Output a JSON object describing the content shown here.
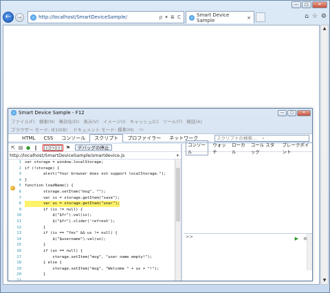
{
  "browser": {
    "url": "http://localhost/SmartDeviceSample/",
    "address_controls": "ρ ▾ ≣ C",
    "tab_title": "Smart Device Sample",
    "tab_close": "×",
    "back": "←",
    "forward": "→",
    "window_buttons": {
      "min": "—",
      "max": "□",
      "close": "✕"
    },
    "right_icons": {
      "home": "⌂",
      "favorites": "☆",
      "settings": "⚙"
    }
  },
  "devtools": {
    "title": "Smart Device Sample - F12",
    "window_buttons": {
      "min": "—",
      "max": "□",
      "close": "✕"
    },
    "menu": [
      "ファイル(F)",
      "検索(N)",
      "無効化(D)",
      "表示(V)",
      "イメージ(I)",
      "キャッシュ(C)",
      "ツール(T)",
      "検証(A)"
    ],
    "mode": {
      "browser_mode": "ブラウザー モード: IE10(B)",
      "document_mode": "ドキュメント モード: 標準(M)"
    },
    "tabs": [
      {
        "label": "HTML"
      },
      {
        "label": "CSS"
      },
      {
        "label": "コンソール"
      },
      {
        "label": "スクリプト"
      },
      {
        "label": "プロファイラー"
      },
      {
        "label": "ネットワーク"
      }
    ],
    "search_placeholder": "スクリプトの検索...",
    "stop_debug_label": "デバッグの停止",
    "file_path": "http://localhost/SmartDeviceSample/smartdevice.js",
    "right_tabs": [
      "コンソール",
      "ウォッチ",
      "ローカル",
      "コール スタック",
      "ブレークポイント"
    ],
    "console_prompt": ">>",
    "code_lines": [
      {
        "n": "1",
        "t": "var storage = window.localStorage;"
      },
      {
        "n": "2",
        "t": "if (!storage) {"
      },
      {
        "n": "3",
        "t": "        alert(\"Your browser does not support localStorage.\");"
      },
      {
        "n": "4",
        "t": "}"
      },
      {
        "n": "5",
        "t": "function loadName() {"
      },
      {
        "n": "6",
        "t": "        storage.setItem(\"msg\", \"\");"
      },
      {
        "n": "7",
        "t": "        var is = storage.getItem(\"save\");"
      },
      {
        "n": "8",
        "t": "        var us = storage.getItem(\"user\");",
        "hl": true
      },
      {
        "n": "9",
        "t": "        if (is != null) {"
      },
      {
        "n": "10",
        "t": "            $(\"$fr\").val(is);"
      },
      {
        "n": "11",
        "t": "            $(\"$fr\").slider('refresh');"
      },
      {
        "n": "12",
        "t": "        }"
      },
      {
        "n": "13",
        "t": "        if (is == \"Yes\" && us != null) {"
      },
      {
        "n": "14",
        "t": "            $(\"$username\").val(us);"
      },
      {
        "n": "15",
        "t": "        }"
      },
      {
        "n": "16",
        "t": "        if (us == null) {"
      },
      {
        "n": "17",
        "t": "            storage.setItem(\"msg\", \"user name empty!\");"
      },
      {
        "n": "18",
        "t": "        } else {"
      },
      {
        "n": "19",
        "t": "            storage.setItem(\"msg\", \"Welcome \" + us + \"!\");"
      },
      {
        "n": "20",
        "t": "        }"
      },
      {
        "n": "21",
        "t": ""
      },
      {
        "n": "22",
        "t": "                        (\"\") "
      }
    ]
  }
}
